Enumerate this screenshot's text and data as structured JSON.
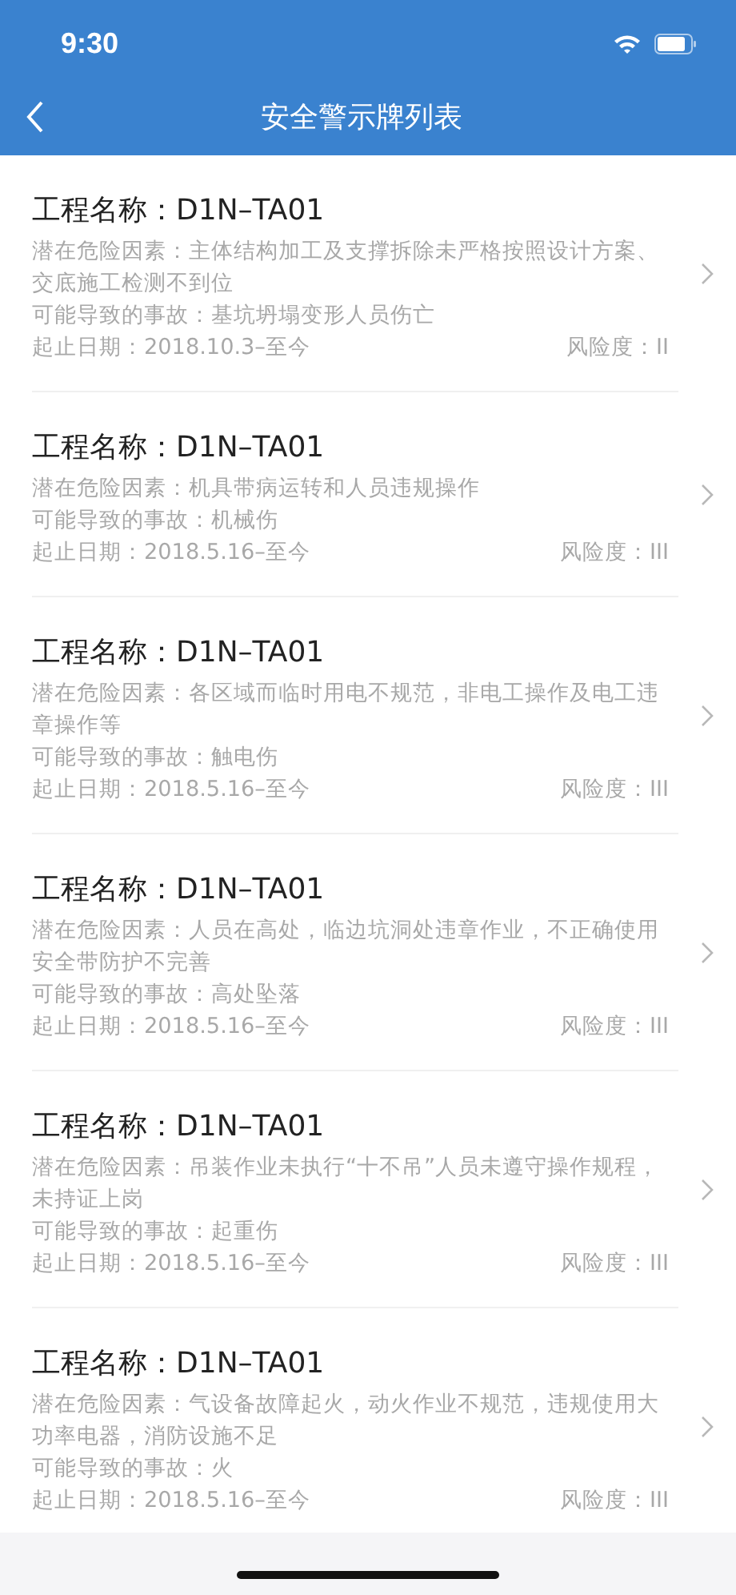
{
  "status_bar": {
    "time": "9:30"
  },
  "nav": {
    "title": "安全警示牌列表"
  },
  "items": [
    {
      "title": "工程名称：D1N–TA01",
      "hazard": "潜在危险因素：主体结构加工及支撑拆除未严格按照设计方案、交底施工检测不到位",
      "accident": "可能导致的事故：基坑坍塌变形人员伤亡",
      "dates": "起止日期：2018.10.3–至今",
      "risk": "风险度：II"
    },
    {
      "title": "工程名称：D1N–TA01",
      "hazard": "潜在危险因素：机具带病运转和人员违规操作",
      "accident": "可能导致的事故：机械伤",
      "dates": "起止日期：2018.5.16–至今",
      "risk": "风险度：III"
    },
    {
      "title": "工程名称：D1N–TA01",
      "hazard": "潜在危险因素：各区域而临时用电不规范，非电工操作及电工违章操作等",
      "accident": "可能导致的事故：触电伤",
      "dates": "起止日期：2018.5.16–至今",
      "risk": "风险度：III"
    },
    {
      "title": "工程名称：D1N–TA01",
      "hazard": "潜在危险因素：人员在高处，临边坑洞处违章作业，不正确使用安全带防护不完善",
      "accident": "可能导致的事故：高处坠落",
      "dates": "起止日期：2018.5.16–至今",
      "risk": "风险度：III"
    },
    {
      "title": "工程名称：D1N–TA01",
      "hazard": "潜在危险因素：吊装作业未执行“十不吊”人员未遵守操作规程，未持证上岗",
      "accident": "可能导致的事故：起重伤",
      "dates": "起止日期：2018.5.16–至今",
      "risk": "风险度：III"
    },
    {
      "title": "工程名称：D1N–TA01",
      "hazard": "潜在危险因素：气设备故障起火，动火作业不规范，违规使用大功率电器，消防设施不足",
      "accident": "可能导致的事故：火",
      "dates": "起止日期：2018.5.16–至今",
      "risk": "风险度：III"
    }
  ]
}
